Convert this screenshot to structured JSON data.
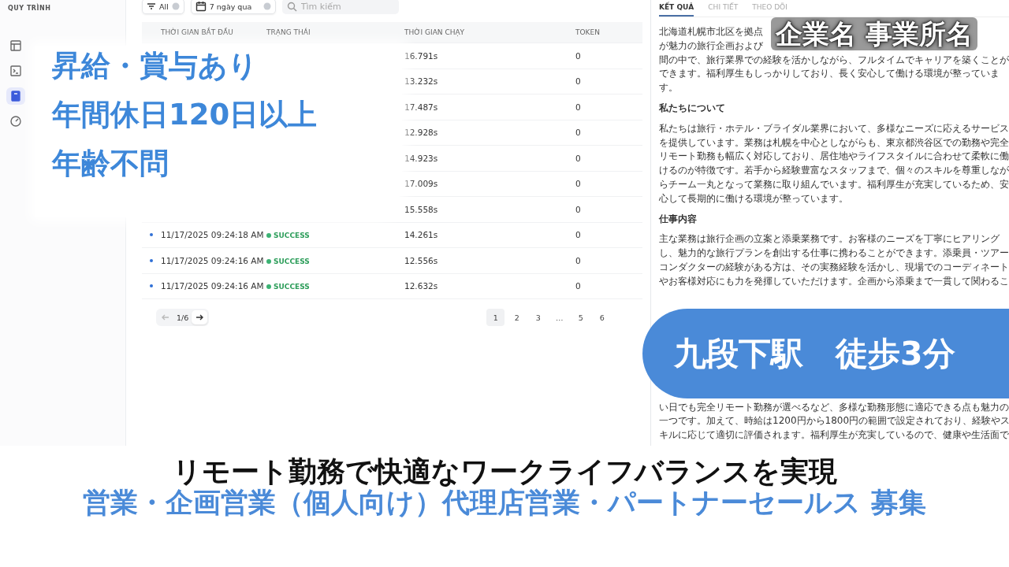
{
  "sidebar": {
    "subtitle": "QUY TRÌNH",
    "items": [
      {
        "selected": false
      },
      {
        "selected": false
      },
      {
        "selected": true
      },
      {
        "selected": false
      }
    ]
  },
  "filters": {
    "status_chip": "All",
    "date_chip": "7 ngày qua",
    "search": {
      "placeholder": "Tìm kiếm"
    }
  },
  "table": {
    "columns": [
      "THỜI GIAN BẮT ĐẦU",
      "TRẠNG THÁI",
      "THỜI GIAN CHẠY",
      "TOKEN"
    ],
    "rows": [
      {
        "duration": "16.791s",
        "token": "0"
      },
      {
        "duration": "13.232s",
        "token": "0"
      },
      {
        "duration": "17.487s",
        "token": "0"
      },
      {
        "duration": "12.928s",
        "token": "0"
      },
      {
        "duration": "14.923s",
        "token": "0"
      },
      {
        "duration": "17.009s",
        "token": "0"
      },
      {
        "duration": "15.558s",
        "token": "0"
      },
      {
        "start": "11/17/2025 09:24:18 AM",
        "status": "SUCCESS",
        "duration": "14.261s",
        "token": "0"
      },
      {
        "start": "11/17/2025 09:24:16 AM",
        "status": "SUCCESS",
        "duration": "12.556s",
        "token": "0"
      },
      {
        "start": "11/17/2025 09:24:16 AM",
        "status": "SUCCESS",
        "duration": "12.632s",
        "token": "0"
      }
    ]
  },
  "pagination": {
    "page_indicator": "1/6",
    "prev_disabled": true,
    "pages": [
      {
        "label": "1",
        "selected": true
      },
      {
        "label": "2",
        "selected": false
      },
      {
        "label": "3",
        "selected": false
      },
      {
        "label": "…",
        "selected": false
      },
      {
        "label": "5",
        "selected": false
      },
      {
        "label": "6",
        "selected": false
      }
    ]
  },
  "detail_panel": {
    "tabs": [
      {
        "label": "KẾT QUẢ",
        "selected": true
      },
      {
        "label": "CHI TIẾT",
        "selected": false
      },
      {
        "label": "THEO DÕI",
        "selected": false
      }
    ],
    "blocks": [
      {
        "kind": "text",
        "lines": [
          "北海道札幌市北区を拠点",
          "が魅力の旅行企画および",
          "間の中で、旅行業界での経験を活かしながら、フルタイムでキャリアを築くことが",
          "できます。福利厚生もしっかりしており、長く安心して働ける環境が整っていま",
          "す。"
        ]
      },
      {
        "kind": "heading",
        "lines": [
          "私たちについて"
        ]
      },
      {
        "kind": "text",
        "lines": [
          "私たちは旅行・ホテル・ブライダル業界において、多様なニーズに応えるサービス",
          "を提供しています。業務は札幌を中心としながらも、東京都渋谷区での勤務や完全",
          "リモート勤務も幅広く対応しており、居住地やライフスタイルに合わせて柔軟に働",
          "けるのが特徴です。若手から経験豊富なスタッフまで、個々のスキルを尊重しなが",
          "らチーム一丸となって業務に取り組んでいます。福利厚生が充実しているため、安",
          "心して長期的に働ける環境が整っています。"
        ]
      },
      {
        "kind": "heading",
        "lines": [
          "仕事内容"
        ]
      },
      {
        "kind": "text",
        "lines": [
          "主な業務は旅行企画の立案と添乗業務です。お客様のニーズを丁寧にヒアリング",
          "し、魅力的な旅行プランを創出する仕事に携わることができます。添乗員・ツアー",
          "コンダクターの経験がある方は、その実務経験を活かし、現場でのコーディネート",
          "やお客様対応にも力を発揮していただけます。企画から添乗まで一貫して関わるこ"
        ]
      },
      {
        "kind": "gap"
      },
      {
        "kind": "text",
        "lines": [
          "い日でも完全リモート勤務が選べるなど、多様な勤務形態に適応できる点も魅力の",
          "一つです。加えて、時給は1200円から1800円の範囲で設定されており、経験やス",
          "キルに応じて適切に評価されます。福利厚生が充実しているので、健康や生活面で"
        ]
      }
    ]
  },
  "overlays": {
    "perks": [
      "昇給・賞与あり",
      "年間休日120日以上",
      "年齢不問"
    ],
    "company_stamp": "企業名 事業所名",
    "station_badge": "九段下駅　徒歩3分",
    "headline": "リモート勤務で快適なワークライフバランスを実現",
    "job_title": "営業・企画営業（個人向け）代理店営業・パートナーセールス 募集"
  }
}
